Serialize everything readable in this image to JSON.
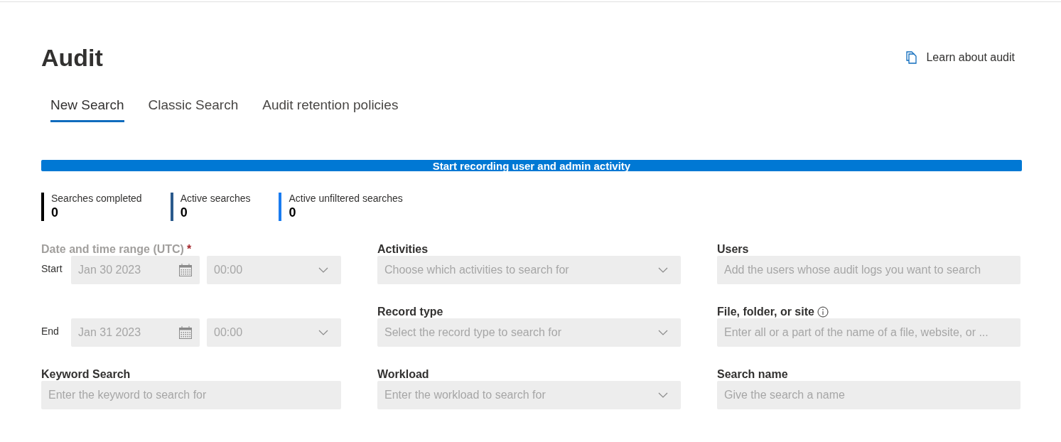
{
  "header": {
    "title": "Audit",
    "learn_link": "Learn about audit"
  },
  "tabs": [
    {
      "label": "New Search",
      "selected": true
    },
    {
      "label": "Classic Search",
      "selected": false
    },
    {
      "label": "Audit retention policies",
      "selected": false
    }
  ],
  "banner": {
    "text": "Start recording user and admin activity"
  },
  "stats": [
    {
      "label": "Searches completed",
      "value": "0",
      "color": "#000000"
    },
    {
      "label": "Active searches",
      "value": "0",
      "color": "#2b5a8c"
    },
    {
      "label": "Active unfiltered searches",
      "value": "0",
      "color": "#1a7cf0"
    }
  ],
  "date_range": {
    "label": "Date and time range (UTC)",
    "required_mark": "*",
    "disabled": true,
    "rows": [
      {
        "label": "Start",
        "date": "Jan 30 2023",
        "time": "00:00"
      },
      {
        "label": "End",
        "date": "Jan 31 2023",
        "time": "00:00"
      }
    ]
  },
  "keyword_search": {
    "label": "Keyword Search",
    "placeholder": "Enter the keyword to search for",
    "kind": "text",
    "info": false
  },
  "middle_column": [
    {
      "label": "Activities",
      "placeholder": "Choose which activities to search for",
      "kind": "dropdown",
      "info": false
    },
    {
      "label": "Record type",
      "placeholder": "Select the record type to search for",
      "kind": "dropdown",
      "info": false
    },
    {
      "label": "Workload",
      "placeholder": "Enter the workload to search for",
      "kind": "dropdown",
      "info": false
    }
  ],
  "right_column": [
    {
      "label": "Users",
      "placeholder": "Add the users whose audit logs you want to search",
      "kind": "text",
      "info": false
    },
    {
      "label": "File, folder, or site",
      "placeholder": "Enter all or a part of the name of a file, website, or ...",
      "kind": "text",
      "info": true
    },
    {
      "label": "Search name",
      "placeholder": "Give the search a name",
      "kind": "text",
      "info": false
    }
  ]
}
